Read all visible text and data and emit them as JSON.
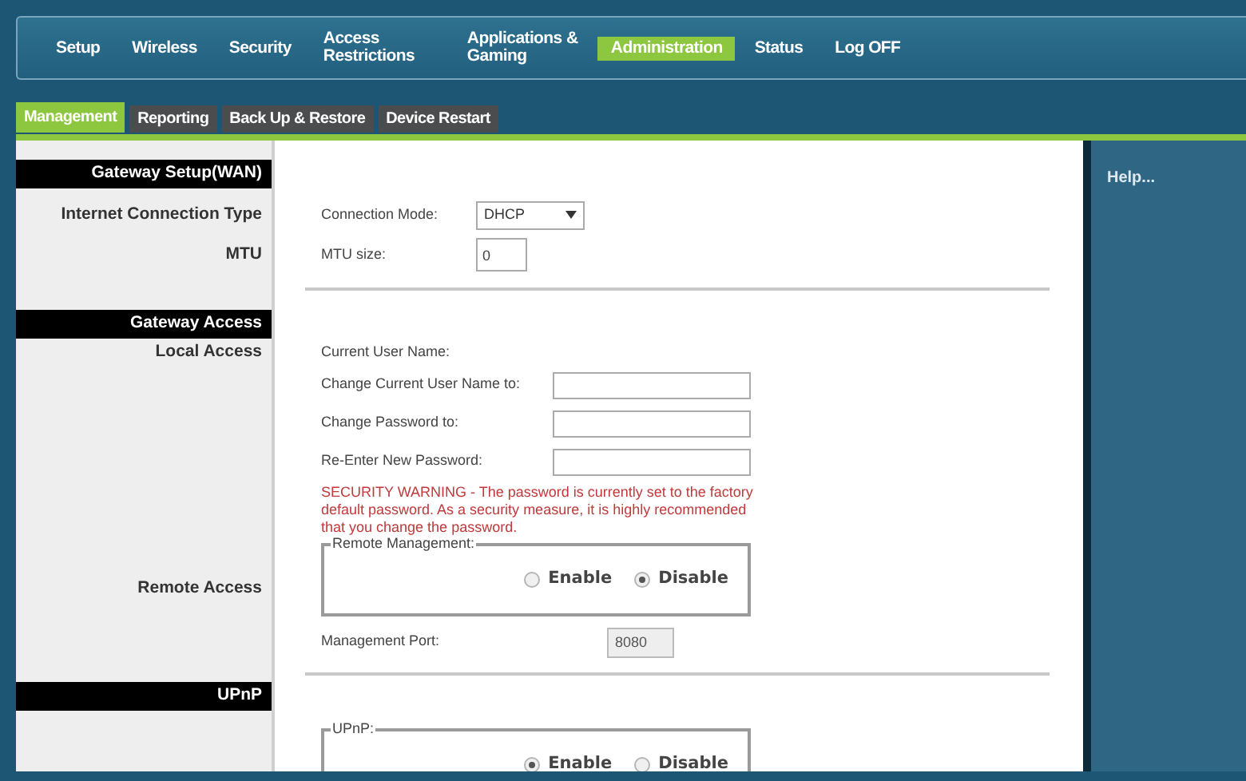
{
  "nav": [
    {
      "label": "Setup",
      "selected": false
    },
    {
      "label": "Wireless",
      "selected": false
    },
    {
      "label": "Security",
      "selected": false
    },
    {
      "label": "Access Restrictions",
      "selected": false
    },
    {
      "label": "Applications & Gaming",
      "selected": false
    },
    {
      "label": "Administration",
      "selected": true
    },
    {
      "label": "Status",
      "selected": false
    },
    {
      "label": "Log OFF",
      "selected": false
    }
  ],
  "subtabs": [
    {
      "label": "Management",
      "selected": true
    },
    {
      "label": "Reporting",
      "selected": false
    },
    {
      "label": "Back Up & Restore",
      "selected": false
    },
    {
      "label": "Device Restart",
      "selected": false
    }
  ],
  "help": "Help...",
  "sections": [
    {
      "title": "Gateway Setup(WAN)",
      "rows": [
        {
          "label": "Internet Connection Type",
          "kind": "select",
          "text": "Connection Mode:",
          "value": "DHCP"
        },
        {
          "label": "MTU",
          "kind": "small-input",
          "text": "MTU size:",
          "value": "0"
        }
      ]
    },
    {
      "title": "Gateway Access",
      "rows": [
        {
          "label": "Local Access",
          "kind": "text",
          "text": "Current User Name:"
        },
        {
          "kind": "input",
          "text": "Change Current User Name to:"
        },
        {
          "kind": "input",
          "text": "Change Password to:"
        },
        {
          "kind": "input",
          "text": "Re-Enter New Password:"
        },
        {
          "kind": "warning",
          "text": "SECURITY WARNING - The password is currently set to the factory default password. As a security measure, it is highly recommended that you change the password."
        },
        {
          "label": "Remote Access",
          "kind": "radio-group",
          "legend": "Remote Management:",
          "options": [
            {
              "label": "Enable",
              "selected": false
            },
            {
              "label": "Disable",
              "selected": true
            }
          ]
        },
        {
          "kind": "port-input",
          "text": "Management Port:",
          "value": "8080"
        }
      ]
    },
    {
      "title": "UPnP",
      "rows": [
        {
          "kind": "radio-group",
          "legend": "UPnP:",
          "options": [
            {
              "label": "Enable",
              "selected": true
            },
            {
              "label": "Disable",
              "selected": false
            }
          ]
        }
      ]
    }
  ]
}
